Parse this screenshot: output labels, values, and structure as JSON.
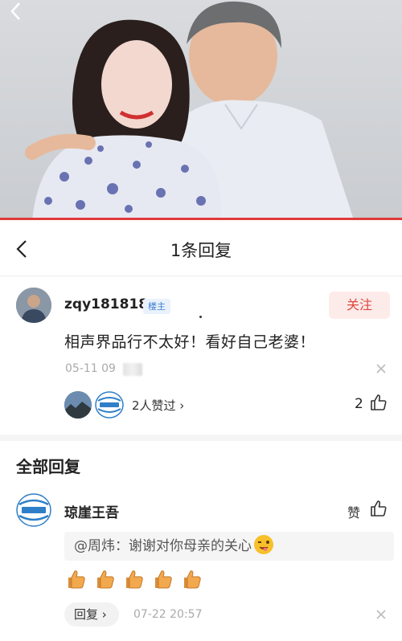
{
  "header": {
    "title": "1条回复"
  },
  "main_comment": {
    "username": "zqy181818",
    "badge": "楼主",
    "follow_label": "关注",
    "content": "相声界品行不太好！看好自己老婆！",
    "time": "05-11 09",
    "likers_text": "2人赞过 ›",
    "like_count": "2"
  },
  "section_title": "全部回复",
  "reply": {
    "username": "琼崖王吾",
    "like_label": "赞",
    "quote": "@周炜：谢谢对你母亲的关心",
    "reply_label": "回复 ›",
    "time": "07-22 20:57"
  },
  "colors": {
    "accent": "#e03a3a",
    "follow_bg": "#fdebea",
    "badge_blue": "#3d7fd0"
  },
  "icons": [
    "back-chevron-icon",
    "close-icon",
    "thumb-up-icon",
    "wink-emoji-icon",
    "thumbs-up-emoji-icon"
  ]
}
